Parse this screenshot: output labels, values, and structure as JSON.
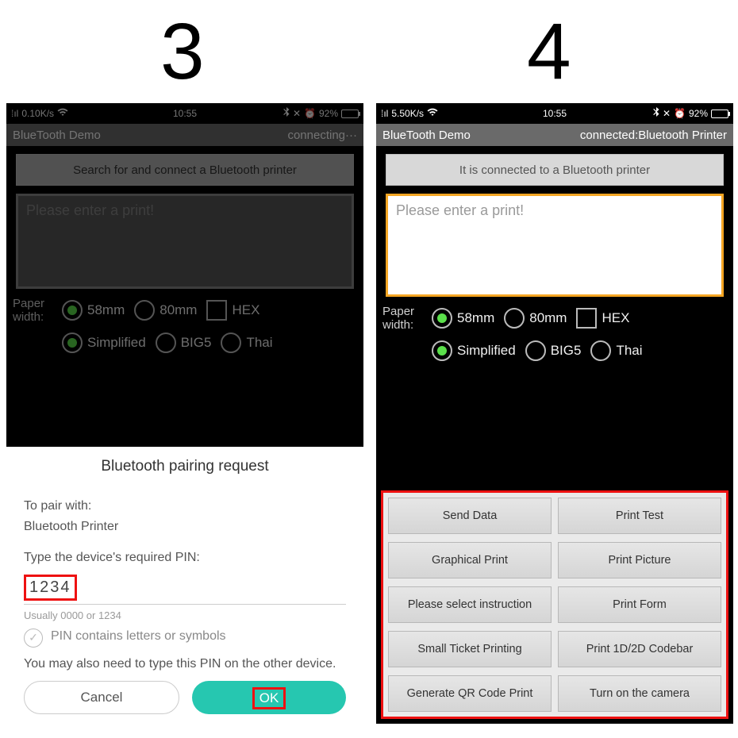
{
  "step_labels": {
    "s3": "3",
    "s4": "4"
  },
  "status": {
    "left_speed": "0.10K/s",
    "right_speed": "5.50K/s",
    "time": "10:55",
    "battery": "92%"
  },
  "app": {
    "title": "BlueTooth Demo",
    "status_left": "connecting···",
    "status_right": "connected:Bluetooth Printer"
  },
  "connect_btn": {
    "left": "Search for and connect a Bluetooth printer",
    "right": "It is connected to a Bluetooth printer"
  },
  "textarea_placeholder": "Please enter a print!",
  "options": {
    "paper_label": "Paper width:",
    "w58": "58mm",
    "w80": "80mm",
    "hex": "HEX",
    "simplified": "Simplified",
    "big5": "BIG5",
    "thai": "Thai"
  },
  "dialog": {
    "title": "Bluetooth pairing request",
    "pair_with_label": "To pair with:",
    "device_name": "Bluetooth Printer",
    "pin_prompt": "Type the device's required PIN:",
    "pin_value": "1234",
    "pin_hint": "Usually 0000 or 1234",
    "pin_symbols": "PIN contains letters or symbols",
    "also_note": "You may also need to type this PIN on the other device.",
    "cancel": "Cancel",
    "ok": "OK"
  },
  "actions": [
    "Send Data",
    "Print Test",
    "Graphical Print",
    "Print Picture",
    "Please select instruction",
    "Print Form",
    "Small Ticket Printing",
    "Print 1D/2D Codebar",
    "Generate QR Code Print",
    "Turn on the camera"
  ]
}
